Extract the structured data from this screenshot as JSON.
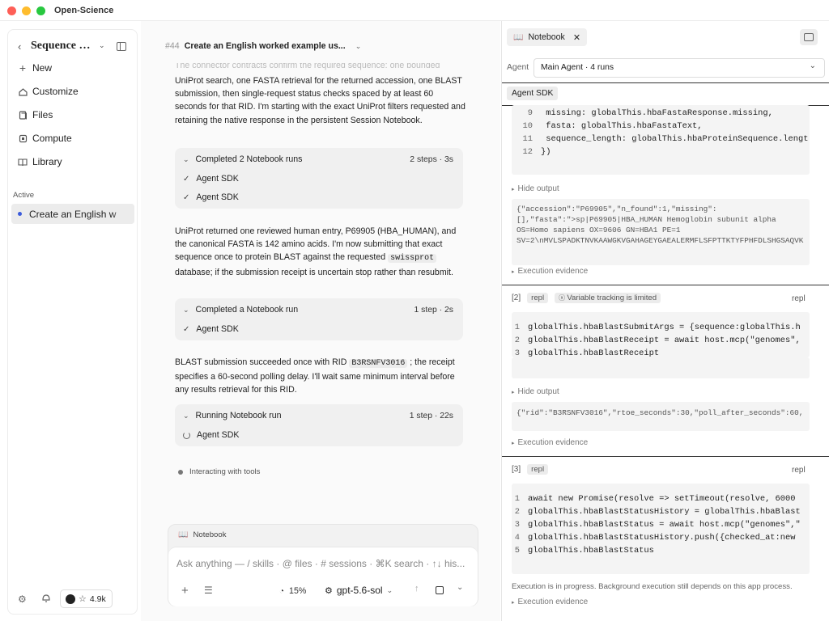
{
  "app": {
    "title": "Open-Science",
    "traffic_colors": [
      "#fe5f57",
      "#febc2e",
      "#28c840"
    ]
  },
  "sidebar": {
    "title": "Sequence …",
    "items": [
      {
        "label": "New",
        "icon": "plus-icon"
      },
      {
        "label": "Customize",
        "icon": "customize-icon"
      },
      {
        "label": "Files",
        "icon": "files-icon"
      },
      {
        "label": "Compute",
        "icon": "compute-icon"
      },
      {
        "label": "Library",
        "icon": "library-icon"
      }
    ],
    "section_label": "Active",
    "active_session": "Create an English w",
    "github_stars": "4.9k"
  },
  "chat": {
    "header_num": "#44",
    "header_title": "Create an English worked example us...",
    "faded_line": "The connector contracts confirm the required sequence: one bounded",
    "para1": "UniProt search, one FASTA retrieval for the returned accession, one BLAST submission, then single-request status checks spaced by at least 60 seconds for that RID. I'm starting with the exact UniProt filters requested and retaining the native response in the persistent Session Notebook.",
    "run1": {
      "title": "Completed 2 Notebook runs",
      "meta": "2 steps · 3s",
      "items": [
        "Agent SDK",
        "Agent SDK"
      ]
    },
    "para2_a": "UniProt returned one reviewed human entry, P69905 (HBA_HUMAN), and the canonical FASTA is 142 amino acids. I'm now submitting that exact sequence once to protein BLAST against the requested",
    "para2_code": "swissprot",
    "para2_b": "database; if the submission receipt is uncertain stop rather than resubmit.",
    "run2": {
      "title": "Completed a Notebook run",
      "meta": "1 step · 2s",
      "items": [
        "Agent SDK"
      ]
    },
    "para3_a": "BLAST submission succeeded once with RID",
    "para3_code": "B3RSNFV3016",
    "para3_b": "; the receipt specifies a 60-second polling delay. I'll wait same minimum interval before any results retrieval for this RID.",
    "run3": {
      "title": "Running Notebook run",
      "meta": "1 step · 22s",
      "items": [
        "Agent SDK"
      ]
    },
    "status": "Interacting with tools"
  },
  "composer": {
    "attachment": "Notebook",
    "placeholder": "Ask anything — / skills · @ files · # sessions · ⌘K search · ↑↓ his...",
    "context_pct": "15%",
    "model": "gpt-5.6-sol"
  },
  "notebook": {
    "tab_label": "Notebook",
    "agent_label": "Agent",
    "agent_select": "Main Agent · 4 runs",
    "sdk_label": "Agent SDK",
    "cell1": {
      "lines": [
        {
          "n": "9",
          "t": "  missing: globalThis.hbaFastaResponse.missing,"
        },
        {
          "n": "10",
          "t": "  fasta: globalThis.hbaFastaText,"
        },
        {
          "n": "11",
          "t": "  sequence_length: globalThis.hbaProteinSequence.lengt"
        },
        {
          "n": "12",
          "t": "})"
        }
      ],
      "hide_output": "Hide output",
      "output": [
        "{\"accession\":\"P69905\",\"n_found\":1,\"missing\":",
        "[],\"fasta\":\">sp|P69905|HBA_HUMAN Hemoglobin subunit alpha",
        "OS=Homo sapiens OX=9606 GN=HBA1 PE=1",
        "SV=2\\nMVLSPADKTNVKAAWGKVGAHAGEYGAEALERMFLSFPTTKTYFPHFDLSHGSAQVK"
      ],
      "evidence": "Execution evidence"
    },
    "cell2": {
      "index": "[2]",
      "tag": "repl",
      "note": "Variable tracking is limited",
      "kind": "repl",
      "lines": [
        {
          "n": "1",
          "t": "globalThis.hbaBlastSubmitArgs = {sequence:globalThis.h"
        },
        {
          "n": "2",
          "t": "globalThis.hbaBlastReceipt = await host.mcp(\"genomes\","
        },
        {
          "n": "3",
          "t": "globalThis.hbaBlastReceipt"
        }
      ],
      "hide_output": "Hide output",
      "output": "{\"rid\":\"B3RSNFV3016\",\"rtoe_seconds\":30,\"poll_after_seconds\":60,",
      "evidence": "Execution evidence"
    },
    "cell3": {
      "index": "[3]",
      "tag": "repl",
      "kind": "repl",
      "lines": [
        {
          "n": "1",
          "t": "await new Promise(resolve => setTimeout(resolve, 6000"
        },
        {
          "n": "2",
          "t": "globalThis.hbaBlastStatusHistory = globalThis.hbaBlast"
        },
        {
          "n": "3",
          "t": "globalThis.hbaBlastStatus = await host.mcp(\"genomes\",\""
        },
        {
          "n": "4",
          "t": "globalThis.hbaBlastStatusHistory.push({checked_at:new"
        },
        {
          "n": "5",
          "t": "globalThis.hbaBlastStatus"
        }
      ],
      "progress_note": "Execution is in progress. Background execution still depends on this app process.",
      "evidence": "Execution evidence"
    }
  }
}
